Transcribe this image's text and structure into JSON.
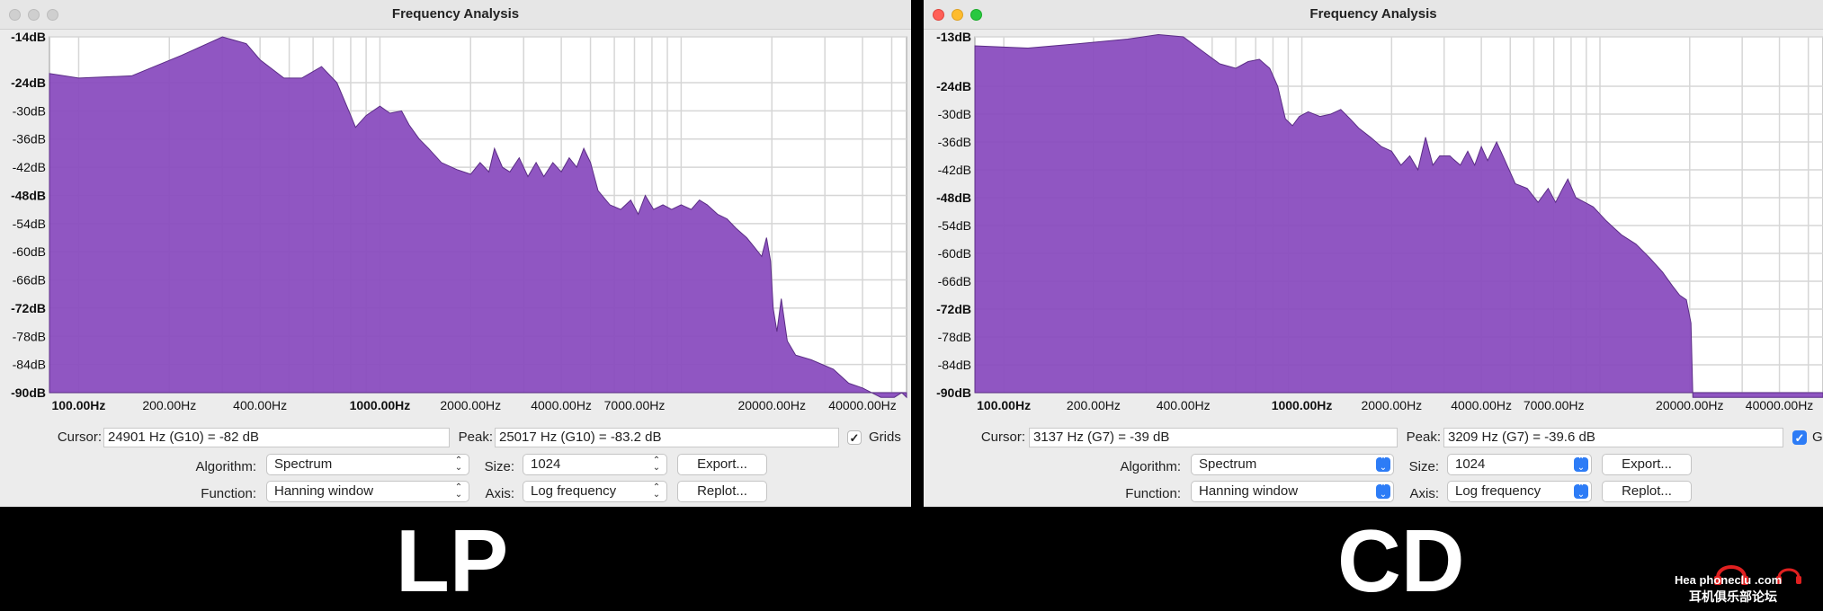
{
  "colors": {
    "fill": "#8a4dbf",
    "edge": "#5b2d86",
    "grid": "#d6d6d6",
    "accent": "#2d7cf6"
  },
  "windows": [
    {
      "id": "L",
      "title": "Frequency Analysis",
      "traffic_lights": "inactive",
      "y_ticks": [
        {
          "label": "-14dB",
          "db": -14,
          "bold": true
        },
        {
          "label": "-24dB",
          "db": -24,
          "bold": true
        },
        {
          "label": "-30dB",
          "db": -30,
          "bold": false
        },
        {
          "label": "-36dB",
          "db": -36,
          "bold": false
        },
        {
          "label": "-42dB",
          "db": -42,
          "bold": false
        },
        {
          "label": "-48dB",
          "db": -48,
          "bold": true
        },
        {
          "label": "-54dB",
          "db": -54,
          "bold": false
        },
        {
          "label": "-60dB",
          "db": -60,
          "bold": false
        },
        {
          "label": "-66dB",
          "db": -66,
          "bold": false
        },
        {
          "label": "-72dB",
          "db": -72,
          "bold": true
        },
        {
          "label": "-78dB",
          "db": -78,
          "bold": false
        },
        {
          "label": "-84dB",
          "db": -84,
          "bold": false
        },
        {
          "label": "-90dB",
          "db": -90,
          "bold": true
        }
      ],
      "x_ticks": [
        {
          "label": "100.00Hz",
          "hz": 100,
          "bold": true
        },
        {
          "label": "200.00Hz",
          "hz": 200,
          "bold": false
        },
        {
          "label": "400.00Hz",
          "hz": 400,
          "bold": false
        },
        {
          "label": "1000.00Hz",
          "hz": 1000,
          "bold": true
        },
        {
          "label": "2000.00Hz",
          "hz": 2000,
          "bold": false
        },
        {
          "label": "4000.00Hz",
          "hz": 4000,
          "bold": false
        },
        {
          "label": "7000.00Hz",
          "hz": 7000,
          "bold": false
        },
        {
          "label": "20000.00Hz",
          "hz": 20000,
          "bold": false
        },
        {
          "label": "40000.00Hz",
          "hz": 40000,
          "bold": false
        }
      ],
      "cursor_label": "Cursor:",
      "cursor_value": "24901 Hz (G10) = -82 dB",
      "peak_label": "Peak:",
      "peak_value": "25017 Hz (G10) = -83.2 dB",
      "grids_label": "Grids",
      "grids_checked": true,
      "algorithm_label": "Algorithm:",
      "algorithm_value": "Spectrum",
      "size_label": "Size:",
      "size_value": "1024",
      "function_label": "Function:",
      "function_value": "Hanning window",
      "axis_label": "Axis:",
      "axis_value": "Log frequency",
      "export_label": "Export...",
      "replot_label": "Replot...",
      "caption": "LP",
      "spectrum": [
        [
          80,
          -22
        ],
        [
          100,
          -23
        ],
        [
          150,
          -22.5
        ],
        [
          220,
          -18
        ],
        [
          300,
          -14
        ],
        [
          360,
          -15.5
        ],
        [
          400,
          -19
        ],
        [
          480,
          -23
        ],
        [
          550,
          -23
        ],
        [
          640,
          -20.5
        ],
        [
          720,
          -24
        ],
        [
          800,
          -31
        ],
        [
          830,
          -33.5
        ],
        [
          900,
          -31
        ],
        [
          1000,
          -29
        ],
        [
          1080,
          -30.5
        ],
        [
          1180,
          -30
        ],
        [
          1250,
          -33
        ],
        [
          1350,
          -36
        ],
        [
          1450,
          -38
        ],
        [
          1600,
          -41
        ],
        [
          1800,
          -42.5
        ],
        [
          2000,
          -43.5
        ],
        [
          2150,
          -41
        ],
        [
          2300,
          -43
        ],
        [
          2400,
          -38
        ],
        [
          2550,
          -42
        ],
        [
          2700,
          -43
        ],
        [
          2900,
          -40
        ],
        [
          3100,
          -44
        ],
        [
          3300,
          -41
        ],
        [
          3500,
          -44
        ],
        [
          3750,
          -41
        ],
        [
          4000,
          -43
        ],
        [
          4250,
          -40
        ],
        [
          4500,
          -42
        ],
        [
          4750,
          -38
        ],
        [
          5000,
          -41
        ],
        [
          5300,
          -47
        ],
        [
          5800,
          -50
        ],
        [
          6300,
          -51
        ],
        [
          6800,
          -49
        ],
        [
          7200,
          -52
        ],
        [
          7600,
          -48
        ],
        [
          8100,
          -51
        ],
        [
          8700,
          -50
        ],
        [
          9300,
          -51
        ],
        [
          10000,
          -50
        ],
        [
          10800,
          -51
        ],
        [
          11500,
          -49
        ],
        [
          12200,
          -50
        ],
        [
          13200,
          -52
        ],
        [
          14200,
          -53
        ],
        [
          15200,
          -55
        ],
        [
          16500,
          -57
        ],
        [
          17500,
          -59
        ],
        [
          18500,
          -61
        ],
        [
          19200,
          -57
        ],
        [
          19800,
          -62
        ],
        [
          20200,
          -72
        ],
        [
          20800,
          -77
        ],
        [
          21500,
          -70
        ],
        [
          22500,
          -79
        ],
        [
          24000,
          -82
        ],
        [
          27000,
          -83
        ],
        [
          32000,
          -85
        ],
        [
          36000,
          -88
        ],
        [
          40000,
          -89
        ],
        [
          46000,
          -91
        ],
        [
          51000,
          -91
        ],
        [
          54000,
          -90
        ],
        [
          56000,
          -91
        ]
      ]
    },
    {
      "id": "R",
      "title": "Frequency Analysis",
      "traffic_lights": "active",
      "y_ticks": [
        {
          "label": "-13dB",
          "db": -13,
          "bold": true
        },
        {
          "label": "-24dB",
          "db": -24,
          "bold": true
        },
        {
          "label": "-30dB",
          "db": -30,
          "bold": false
        },
        {
          "label": "-36dB",
          "db": -36,
          "bold": false
        },
        {
          "label": "-42dB",
          "db": -42,
          "bold": false
        },
        {
          "label": "-48dB",
          "db": -48,
          "bold": true
        },
        {
          "label": "-54dB",
          "db": -54,
          "bold": false
        },
        {
          "label": "-60dB",
          "db": -60,
          "bold": false
        },
        {
          "label": "-66dB",
          "db": -66,
          "bold": false
        },
        {
          "label": "-72dB",
          "db": -72,
          "bold": true
        },
        {
          "label": "-78dB",
          "db": -78,
          "bold": false
        },
        {
          "label": "-84dB",
          "db": -84,
          "bold": false
        },
        {
          "label": "-90dB",
          "db": -90,
          "bold": true
        }
      ],
      "x_ticks": [
        {
          "label": "100.00Hz",
          "hz": 100,
          "bold": true
        },
        {
          "label": "200.00Hz",
          "hz": 200,
          "bold": false
        },
        {
          "label": "400.00Hz",
          "hz": 400,
          "bold": false
        },
        {
          "label": "1000.00Hz",
          "hz": 1000,
          "bold": true
        },
        {
          "label": "2000.00Hz",
          "hz": 2000,
          "bold": false
        },
        {
          "label": "4000.00Hz",
          "hz": 4000,
          "bold": false
        },
        {
          "label": "7000.00Hz",
          "hz": 7000,
          "bold": false
        },
        {
          "label": "20000.00Hz",
          "hz": 20000,
          "bold": false
        },
        {
          "label": "40000.00Hz",
          "hz": 40000,
          "bold": false
        }
      ],
      "cursor_label": "Cursor:",
      "cursor_value": "3137 Hz (G7) = -39 dB",
      "peak_label": "Peak:",
      "peak_value": "3209 Hz (G7) = -39.6 dB",
      "grids_label": "Grids",
      "grids_checked": true,
      "algorithm_label": "Algorithm:",
      "algorithm_value": "Spectrum",
      "size_label": "Size:",
      "size_value": "1024",
      "function_label": "Function:",
      "function_value": "Hanning window",
      "axis_label": "Axis:",
      "axis_value": "Log frequency",
      "export_label": "Export...",
      "replot_label": "Replot...",
      "caption": "CD",
      "spectrum": [
        [
          80,
          -15
        ],
        [
          120,
          -15.5
        ],
        [
          180,
          -14.5
        ],
        [
          260,
          -13.5
        ],
        [
          330,
          -12.5
        ],
        [
          400,
          -13
        ],
        [
          460,
          -16
        ],
        [
          530,
          -19
        ],
        [
          600,
          -20
        ],
        [
          660,
          -18.5
        ],
        [
          720,
          -18
        ],
        [
          780,
          -20
        ],
        [
          830,
          -24
        ],
        [
          880,
          -31
        ],
        [
          930,
          -32.5
        ],
        [
          980,
          -30.5
        ],
        [
          1050,
          -29.5
        ],
        [
          1150,
          -30.5
        ],
        [
          1250,
          -30
        ],
        [
          1350,
          -29
        ],
        [
          1450,
          -31
        ],
        [
          1550,
          -33
        ],
        [
          1700,
          -35
        ],
        [
          1850,
          -37
        ],
        [
          2000,
          -38
        ],
        [
          2150,
          -41
        ],
        [
          2300,
          -39
        ],
        [
          2450,
          -42
        ],
        [
          2600,
          -35
        ],
        [
          2750,
          -41
        ],
        [
          2900,
          -39
        ],
        [
          3137,
          -39
        ],
        [
          3209,
          -39.6
        ],
        [
          3400,
          -41
        ],
        [
          3600,
          -38
        ],
        [
          3800,
          -41
        ],
        [
          4000,
          -37
        ],
        [
          4200,
          -40
        ],
        [
          4500,
          -36
        ],
        [
          4800,
          -40
        ],
        [
          5200,
          -45
        ],
        [
          5700,
          -46
        ],
        [
          6200,
          -49
        ],
        [
          6700,
          -46
        ],
        [
          7100,
          -49
        ],
        [
          7500,
          -46
        ],
        [
          7800,
          -44
        ],
        [
          8300,
          -48
        ],
        [
          8900,
          -49
        ],
        [
          9500,
          -50
        ],
        [
          10500,
          -53
        ],
        [
          11800,
          -56
        ],
        [
          13200,
          -58
        ],
        [
          14700,
          -61
        ],
        [
          16200,
          -64
        ],
        [
          17500,
          -67
        ],
        [
          18500,
          -69
        ],
        [
          19500,
          -70
        ],
        [
          20200,
          -75
        ],
        [
          20500,
          -91
        ],
        [
          30000,
          -91
        ],
        [
          45000,
          -91
        ],
        [
          56000,
          -91
        ]
      ]
    }
  ]
}
